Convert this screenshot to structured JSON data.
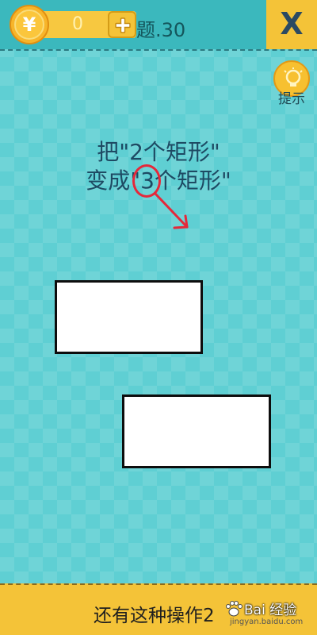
{
  "header": {
    "coins": "0",
    "coin_symbol": "¥",
    "level_label": "题.30",
    "close_label": "X"
  },
  "hint": {
    "label": "提示"
  },
  "question": {
    "line1": "把\"2个矩形\"",
    "line2_prefix": "变成\"",
    "line2_target": "3",
    "line2_suffix": "个矩形\""
  },
  "footer": {
    "text": "还有这种操作2"
  },
  "watermark": {
    "brand": "Bai 经验",
    "url": "jingyan.baidu.com"
  },
  "colors": {
    "background": "#5fcfd3",
    "header": "#3bb8bd",
    "accent_yellow": "#f4c338",
    "annotation_red": "#e5283a",
    "text_dark": "#1e4a63"
  }
}
